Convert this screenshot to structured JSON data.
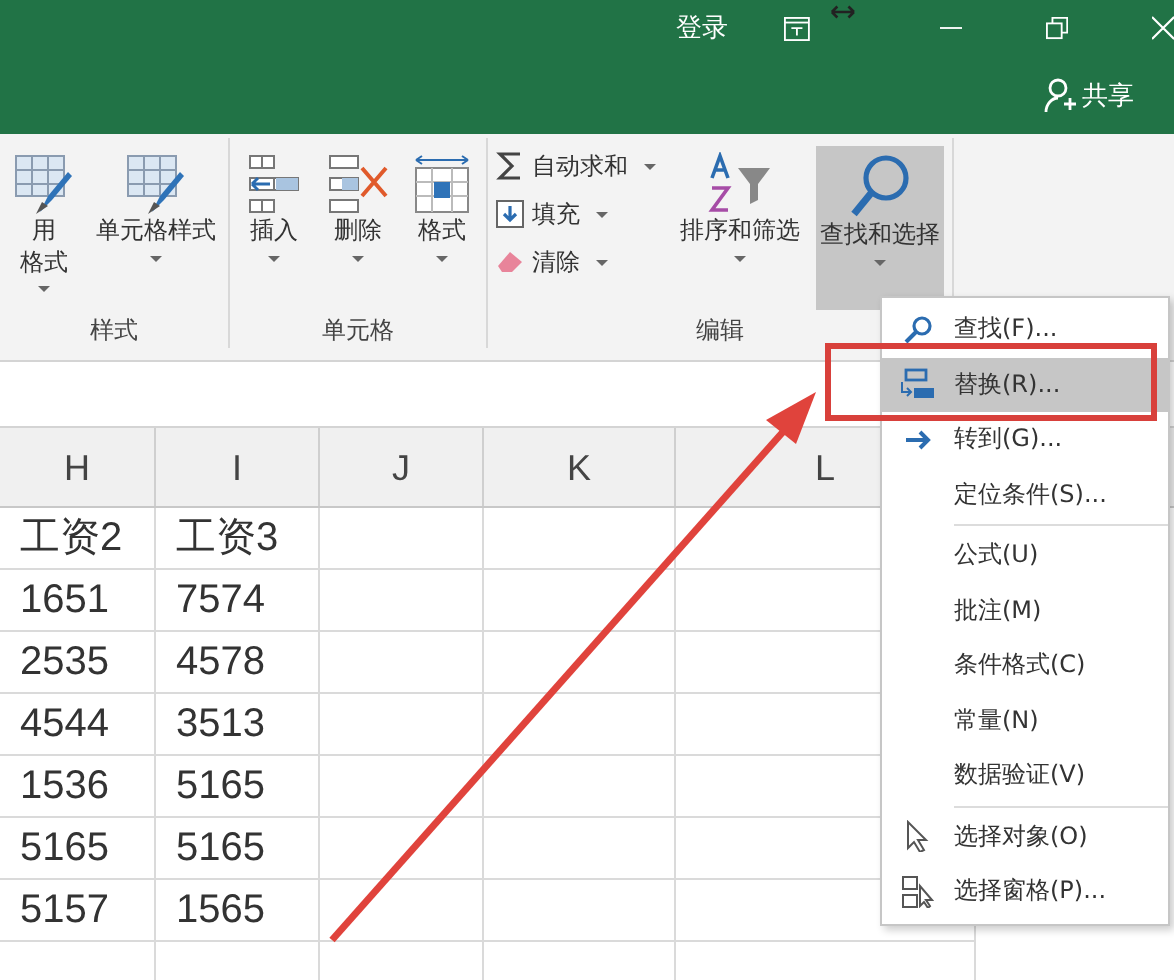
{
  "title_bar": {
    "sign_in": "登录",
    "share": "共享"
  },
  "ribbon": {
    "groups": [
      {
        "label": "样式",
        "commands": [
          {
            "kind": "large",
            "lines": [
              "用",
              "格式"
            ],
            "dropdown": true,
            "selected": false
          },
          {
            "kind": "large",
            "lines": [
              "单元格样式"
            ],
            "dropdown": true,
            "selected": false
          }
        ]
      },
      {
        "label": "单元格",
        "commands": [
          {
            "kind": "large",
            "lines": [
              "插入"
            ],
            "dropdown": true,
            "selected": false
          },
          {
            "kind": "large",
            "lines": [
              "删除"
            ],
            "dropdown": true,
            "selected": false
          },
          {
            "kind": "large",
            "lines": [
              "格式"
            ],
            "dropdown": true,
            "selected": false
          }
        ]
      },
      {
        "label": "编辑",
        "commands": [
          {
            "kind": "small",
            "lines": [
              "自动求和"
            ],
            "dropdown": true,
            "selected": false
          },
          {
            "kind": "small",
            "lines": [
              "填充"
            ],
            "dropdown": true,
            "selected": false
          },
          {
            "kind": "small",
            "lines": [
              "清除"
            ],
            "dropdown": true,
            "selected": false
          },
          {
            "kind": "large",
            "lines": [
              "排序和筛选"
            ],
            "dropdown": true,
            "selected": false
          },
          {
            "kind": "large",
            "lines": [
              "查找和选择"
            ],
            "dropdown": true,
            "selected": true
          }
        ]
      }
    ]
  },
  "sheet": {
    "columns": [
      "H",
      "I",
      "J",
      "K",
      "L"
    ],
    "rows": [
      [
        "工资2",
        "工资3"
      ],
      [
        "1651",
        "7574"
      ],
      [
        "2535",
        "4578"
      ],
      [
        "4544",
        "3513"
      ],
      [
        "1536",
        "5165"
      ],
      [
        "5165",
        "5165"
      ],
      [
        "5157",
        "1565"
      ]
    ]
  },
  "menu": {
    "sections": [
      [
        {
          "label": "查找(F)...",
          "selected": false
        },
        {
          "label": "替换(R)...",
          "selected": true
        },
        {
          "label": "转到(G)...",
          "selected": false
        },
        {
          "label": "定位条件(S)...",
          "selected": false
        }
      ],
      [
        {
          "label": "公式(U)",
          "selected": false
        },
        {
          "label": "批注(M)",
          "selected": false
        },
        {
          "label": "条件格式(C)",
          "selected": false
        },
        {
          "label": "常量(N)",
          "selected": false
        },
        {
          "label": "数据验证(V)",
          "selected": false
        }
      ],
      [
        {
          "label": "选择对象(O)",
          "selected": false
        },
        {
          "label": "选择窗格(P)...",
          "selected": false
        }
      ]
    ]
  }
}
